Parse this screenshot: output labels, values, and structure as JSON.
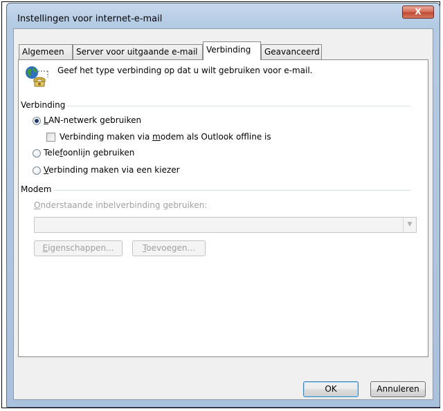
{
  "window": {
    "title": "Instellingen voor internet-e-mail",
    "close_glyph": "X"
  },
  "tabs": [
    {
      "label": "Algemeen",
      "active": false
    },
    {
      "label": "Server voor uitgaande e-mail",
      "active": false
    },
    {
      "label": "Verbinding",
      "active": true
    },
    {
      "label": "Geavanceerd",
      "active": false
    }
  ],
  "panel": {
    "header_icon": "globe-phone-icon",
    "description": "Geef het type verbinding op dat u wilt gebruiken voor e-mail.",
    "connection_group": {
      "title": "Verbinding",
      "options": [
        {
          "label_pre": "",
          "accel": "L",
          "label_post": "AN-netwerk gebruiken",
          "checked": true
        },
        {
          "label_pre": "Tele",
          "accel": "f",
          "label_post": "oonlijn gebruiken",
          "checked": false
        },
        {
          "label_pre": "",
          "accel": "V",
          "label_post": "erbinding maken via een kiezer",
          "checked": false
        }
      ],
      "modem_checkbox": {
        "label_pre": "Verbinding maken via ",
        "accel": "m",
        "label_post": "odem als Outlook offline is",
        "checked": false
      }
    },
    "modem_group": {
      "title": "Modem",
      "dialup_label_accel": "O",
      "dialup_label_rest": "nderstaande inbelverbinding gebruiken:",
      "dialup_value": "",
      "properties_accel": "E",
      "properties_rest": "igenschappen...",
      "add_accel": "T",
      "add_rest": "oevoegen..."
    }
  },
  "footer": {
    "ok_label": "OK",
    "cancel_label": "Annuleren"
  },
  "colors": {
    "title_bar": "#b4cbe4",
    "close_button": "#c04a32",
    "dialog_background": "#f0f0f0",
    "disabled_text": "#a0a0a0"
  }
}
